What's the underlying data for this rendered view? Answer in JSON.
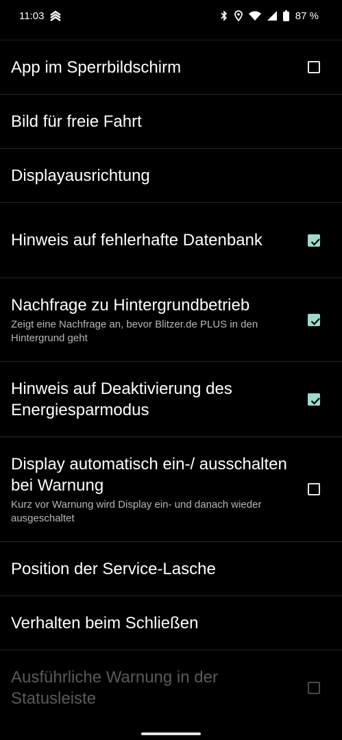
{
  "statusbar": {
    "time": "11:03",
    "battery_percent": "87 %",
    "icons": [
      "app-notification-icon",
      "bluetooth-icon",
      "location-icon",
      "wifi-icon",
      "signal-icon",
      "battery-icon"
    ]
  },
  "settings": {
    "items": [
      {
        "title": "App im Sperrbildschirm",
        "summary": "",
        "checkbox": "unchecked",
        "enabled": true
      },
      {
        "title": "Bild für freie Fahrt",
        "summary": "",
        "checkbox": "none",
        "enabled": true
      },
      {
        "title": "Displayausrichtung",
        "summary": "",
        "checkbox": "none",
        "enabled": true
      },
      {
        "title": "Hinweis auf fehlerhafte Datenbank",
        "summary": "",
        "checkbox": "checked",
        "enabled": true
      },
      {
        "title": "Nachfrage zu Hintergrundbetrieb",
        "summary": "Zeigt eine Nachfrage an, bevor Blitzer.de PLUS in den Hintergrund geht",
        "checkbox": "checked",
        "enabled": true
      },
      {
        "title": "Hinweis auf Deaktivierung des Energiesparmodus",
        "summary": "",
        "checkbox": "checked",
        "enabled": true
      },
      {
        "title": "Display automatisch ein-/ ausschalten bei Warnung",
        "summary": "Kurz vor Warnung wird Display ein- und danach wieder ausgeschaltet",
        "checkbox": "unchecked",
        "enabled": true
      },
      {
        "title": "Position der Service-Lasche",
        "summary": "",
        "checkbox": "none",
        "enabled": true
      },
      {
        "title": "Verhalten beim Schließen",
        "summary": "",
        "checkbox": "none",
        "enabled": true
      },
      {
        "title": "Ausführliche Warnung in der Statusleiste",
        "summary": "",
        "checkbox": "unchecked",
        "enabled": false
      }
    ]
  },
  "colors": {
    "background": "#000000",
    "accent_checkbox": "#9fd8d0",
    "divider": "#262626",
    "disabled_text": "#5a5a5a"
  }
}
